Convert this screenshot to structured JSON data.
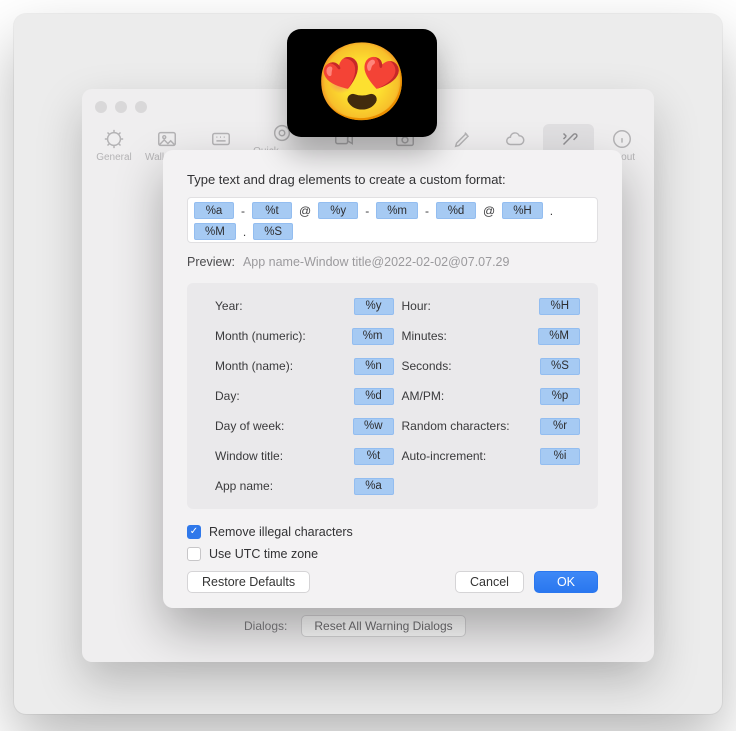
{
  "badge_emoji": "😍",
  "back_window": {
    "toolbar": [
      {
        "name": "general",
        "label": "General",
        "active": false
      },
      {
        "name": "wallpaper",
        "label": "Wallpaper",
        "active": false
      },
      {
        "name": "shortcuts",
        "label": "Shortcuts",
        "active": false
      },
      {
        "name": "quick_access",
        "label": "Quick Access",
        "active": false
      },
      {
        "name": "recording",
        "label": "Recording",
        "active": false
      },
      {
        "name": "screenshots",
        "label": "Screenshots",
        "active": false
      },
      {
        "name": "annotate",
        "label": "Annotate",
        "active": false
      },
      {
        "name": "cloud",
        "label": "Cloud",
        "active": false
      },
      {
        "name": "advanced",
        "label": "Advanced",
        "active": true
      },
      {
        "name": "about",
        "label": "About",
        "active": false
      }
    ],
    "dialogs_label": "Dialogs:",
    "dialogs_button": "Reset All Warning Dialogs"
  },
  "sheet": {
    "title": "Type text and drag elements to create a custom format:",
    "format_tokens": [
      {
        "t": "token",
        "v": "%a"
      },
      {
        "t": "sep",
        "v": "-"
      },
      {
        "t": "token",
        "v": "%t"
      },
      {
        "t": "sep",
        "v": "@"
      },
      {
        "t": "token",
        "v": "%y"
      },
      {
        "t": "sep",
        "v": "-"
      },
      {
        "t": "token",
        "v": "%m"
      },
      {
        "t": "sep",
        "v": "-"
      },
      {
        "t": "token",
        "v": "%d"
      },
      {
        "t": "sep",
        "v": "@"
      },
      {
        "t": "token",
        "v": "%H"
      },
      {
        "t": "sep",
        "v": "."
      },
      {
        "t": "token",
        "v": "%M"
      },
      {
        "t": "sep",
        "v": "."
      },
      {
        "t": "token",
        "v": "%S"
      }
    ],
    "preview_label": "Preview:",
    "preview_value": "App name-Window title@2022-02-02@07.07.29",
    "legend_left": [
      {
        "label": "Year:",
        "token": "%y"
      },
      {
        "label": "Month (numeric):",
        "token": "%m"
      },
      {
        "label": "Month (name):",
        "token": "%n"
      },
      {
        "label": "Day:",
        "token": "%d"
      },
      {
        "label": "Day of week:",
        "token": "%w"
      },
      {
        "label": "Window title:",
        "token": "%t"
      },
      {
        "label": "App name:",
        "token": "%a"
      }
    ],
    "legend_right": [
      {
        "label": "Hour:",
        "token": "%H"
      },
      {
        "label": "Minutes:",
        "token": "%M"
      },
      {
        "label": "Seconds:",
        "token": "%S"
      },
      {
        "label": "AM/PM:",
        "token": "%p"
      },
      {
        "label": "Random characters:",
        "token": "%r"
      },
      {
        "label": "Auto-increment:",
        "token": "%i"
      }
    ],
    "checkbox_remove": {
      "label": "Remove illegal characters",
      "checked": true
    },
    "checkbox_utc": {
      "label": "Use UTC time zone",
      "checked": false
    },
    "restore_label": "Restore Defaults",
    "cancel_label": "Cancel",
    "ok_label": "OK"
  }
}
